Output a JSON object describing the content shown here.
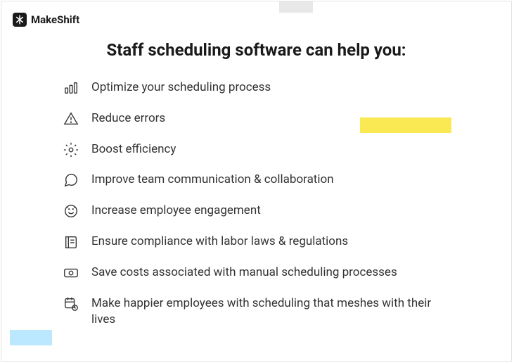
{
  "brand": {
    "name": "MakeShift"
  },
  "heading": "Staff scheduling software can help you:",
  "benefits": [
    {
      "icon": "bar-chart-icon",
      "text": "Optimize your scheduling process"
    },
    {
      "icon": "warning-icon",
      "text": "Reduce errors"
    },
    {
      "icon": "gear-icon",
      "text": "Boost efficiency"
    },
    {
      "icon": "chat-icon",
      "text": "Improve team communication & collaboration"
    },
    {
      "icon": "smile-icon",
      "text": "Increase employee engagement"
    },
    {
      "icon": "book-icon",
      "text": "Ensure compliance with labor laws & regulations"
    },
    {
      "icon": "money-icon",
      "text": "Save costs associated with manual scheduling processes"
    },
    {
      "icon": "calendar-clock-icon",
      "text": "Make happier employees with scheduling that meshes with their lives"
    }
  ]
}
